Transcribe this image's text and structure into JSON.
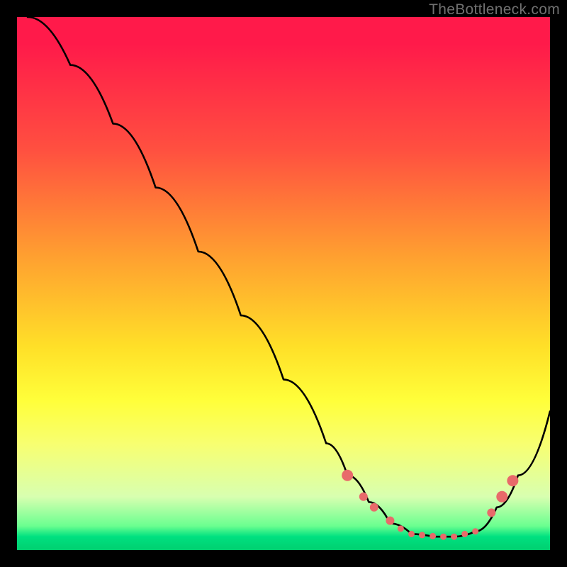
{
  "watermark": "TheBottleneck.com",
  "colors": {
    "frame": "#000000",
    "gradient_top": "#ff1a4a",
    "gradient_mid1": "#ffa030",
    "gradient_mid2": "#ffff3a",
    "gradient_bottom": "#00d070",
    "curve": "#000000",
    "dots": "#e86a6a"
  },
  "chart_data": {
    "type": "line",
    "title": "",
    "xlabel": "",
    "ylabel": "",
    "xlim": [
      0,
      100
    ],
    "ylim": [
      0,
      100
    ],
    "grid": false,
    "legend": false,
    "series": [
      {
        "name": "curve",
        "x": [
          2,
          10,
          18,
          26,
          34,
          42,
          50,
          58,
          62,
          66,
          70,
          74,
          78,
          82,
          86,
          90,
          94,
          100
        ],
        "y": [
          100,
          91,
          80,
          68,
          56,
          44,
          32,
          20,
          14,
          9,
          5,
          3,
          2.5,
          2.5,
          3.5,
          8,
          14,
          26
        ]
      }
    ],
    "markers": [
      {
        "x": 62,
        "y": 14,
        "size": "large"
      },
      {
        "x": 65,
        "y": 10,
        "size": "medium"
      },
      {
        "x": 67,
        "y": 8,
        "size": "medium"
      },
      {
        "x": 70,
        "y": 5.5,
        "size": "medium"
      },
      {
        "x": 72,
        "y": 4,
        "size": "small"
      },
      {
        "x": 74,
        "y": 3,
        "size": "small"
      },
      {
        "x": 76,
        "y": 2.8,
        "size": "small"
      },
      {
        "x": 78,
        "y": 2.6,
        "size": "small"
      },
      {
        "x": 80,
        "y": 2.5,
        "size": "small"
      },
      {
        "x": 82,
        "y": 2.5,
        "size": "small"
      },
      {
        "x": 84,
        "y": 3,
        "size": "small"
      },
      {
        "x": 86,
        "y": 3.5,
        "size": "small"
      },
      {
        "x": 89,
        "y": 7,
        "size": "medium"
      },
      {
        "x": 91,
        "y": 10,
        "size": "large"
      },
      {
        "x": 93,
        "y": 13,
        "size": "large"
      }
    ]
  }
}
